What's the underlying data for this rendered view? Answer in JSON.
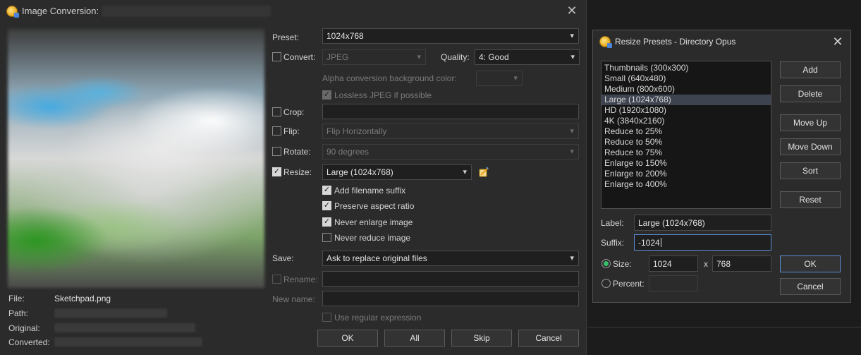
{
  "main": {
    "title": "Image Conversion:",
    "close_glyph": "✕",
    "info": {
      "file_label": "File:",
      "file_value": "Sketchpad.png",
      "path_label": "Path:",
      "original_label": "Original:",
      "converted_label": "Converted:"
    },
    "preset": {
      "label": "Preset:",
      "value": "1024x768"
    },
    "convert": {
      "label": "Convert:",
      "value": "JPEG",
      "checked": false
    },
    "quality": {
      "label": "Quality:",
      "value": "4: Good"
    },
    "alpha": {
      "label": "Alpha conversion background color:"
    },
    "lossless": {
      "label": "Lossless JPEG if possible",
      "checked": true
    },
    "crop": {
      "label": "Crop:",
      "checked": false
    },
    "flip": {
      "label": "Flip:",
      "value": "Flip Horizontally",
      "checked": false
    },
    "rotate": {
      "label": "Rotate:",
      "value": "90 degrees",
      "checked": false
    },
    "resize": {
      "label": "Resize:",
      "value": "Large (1024x768)",
      "checked": true
    },
    "options": {
      "add_suffix": "Add filename suffix",
      "preserve_aspect": "Preserve aspect ratio",
      "never_enlarge": "Never enlarge image",
      "never_reduce": "Never reduce image"
    },
    "save": {
      "label": "Save:",
      "value": "Ask to replace original files"
    },
    "rename": {
      "label": "Rename:"
    },
    "new_name": {
      "label": "New name:"
    },
    "regex": {
      "label": "Use regular expression"
    },
    "buttons": {
      "ok": "OK",
      "all": "All",
      "skip": "Skip",
      "cancel": "Cancel"
    }
  },
  "presets_dialog": {
    "title": "Resize Presets - Directory Opus",
    "close_glyph": "✕",
    "items": [
      "Thumbnails (300x300)",
      "Small (640x480)",
      "Medium (800x600)",
      "Large (1024x768)",
      "HD (1920x1080)",
      "4K (3840x2160)",
      "Reduce to 25%",
      "Reduce to 50%",
      "Reduce to 75%",
      "Enlarge to 150%",
      "Enlarge to 200%",
      "Enlarge to 400%"
    ],
    "selected_item": "Large (1024x768)",
    "buttons": {
      "add": "Add",
      "delete": "Delete",
      "move_up": "Move Up",
      "move_down": "Move Down",
      "sort": "Sort",
      "reset": "Reset",
      "ok": "OK",
      "cancel": "Cancel"
    },
    "label_field": {
      "label": "Label:",
      "value": "Large (1024x768)"
    },
    "suffix_field": {
      "label": "Suffix:",
      "value": "-1024"
    },
    "size": {
      "label": "Size:",
      "width": "1024",
      "separator": "x",
      "height": "768",
      "selected": true
    },
    "percent": {
      "label": "Percent:",
      "value": ""
    },
    "colors": {
      "focus_border": "#5b8fd6",
      "radio_on": "#39c06a",
      "list_selection": "#3e4350"
    }
  }
}
